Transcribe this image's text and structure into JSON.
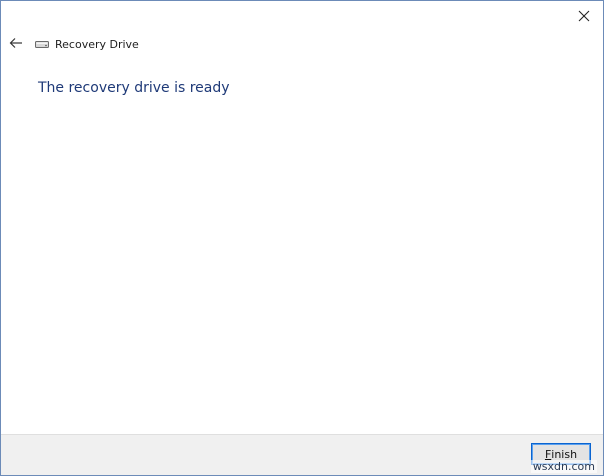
{
  "window": {
    "title": "Recovery Drive",
    "heading": "The recovery drive is ready"
  },
  "titlebar": {
    "close_icon": "close-icon",
    "back_icon": "back-arrow-icon",
    "drive_icon": "drive-icon"
  },
  "footer": {
    "finish_label_mnemonic": "F",
    "finish_label_rest": "inish"
  },
  "watermark": "wsxdn.com",
  "colors": {
    "heading": "#1f3a78",
    "window_border": "#6c8bb8",
    "footer_bg": "#f0f0f0",
    "button_focus_border": "#0a64d0"
  }
}
